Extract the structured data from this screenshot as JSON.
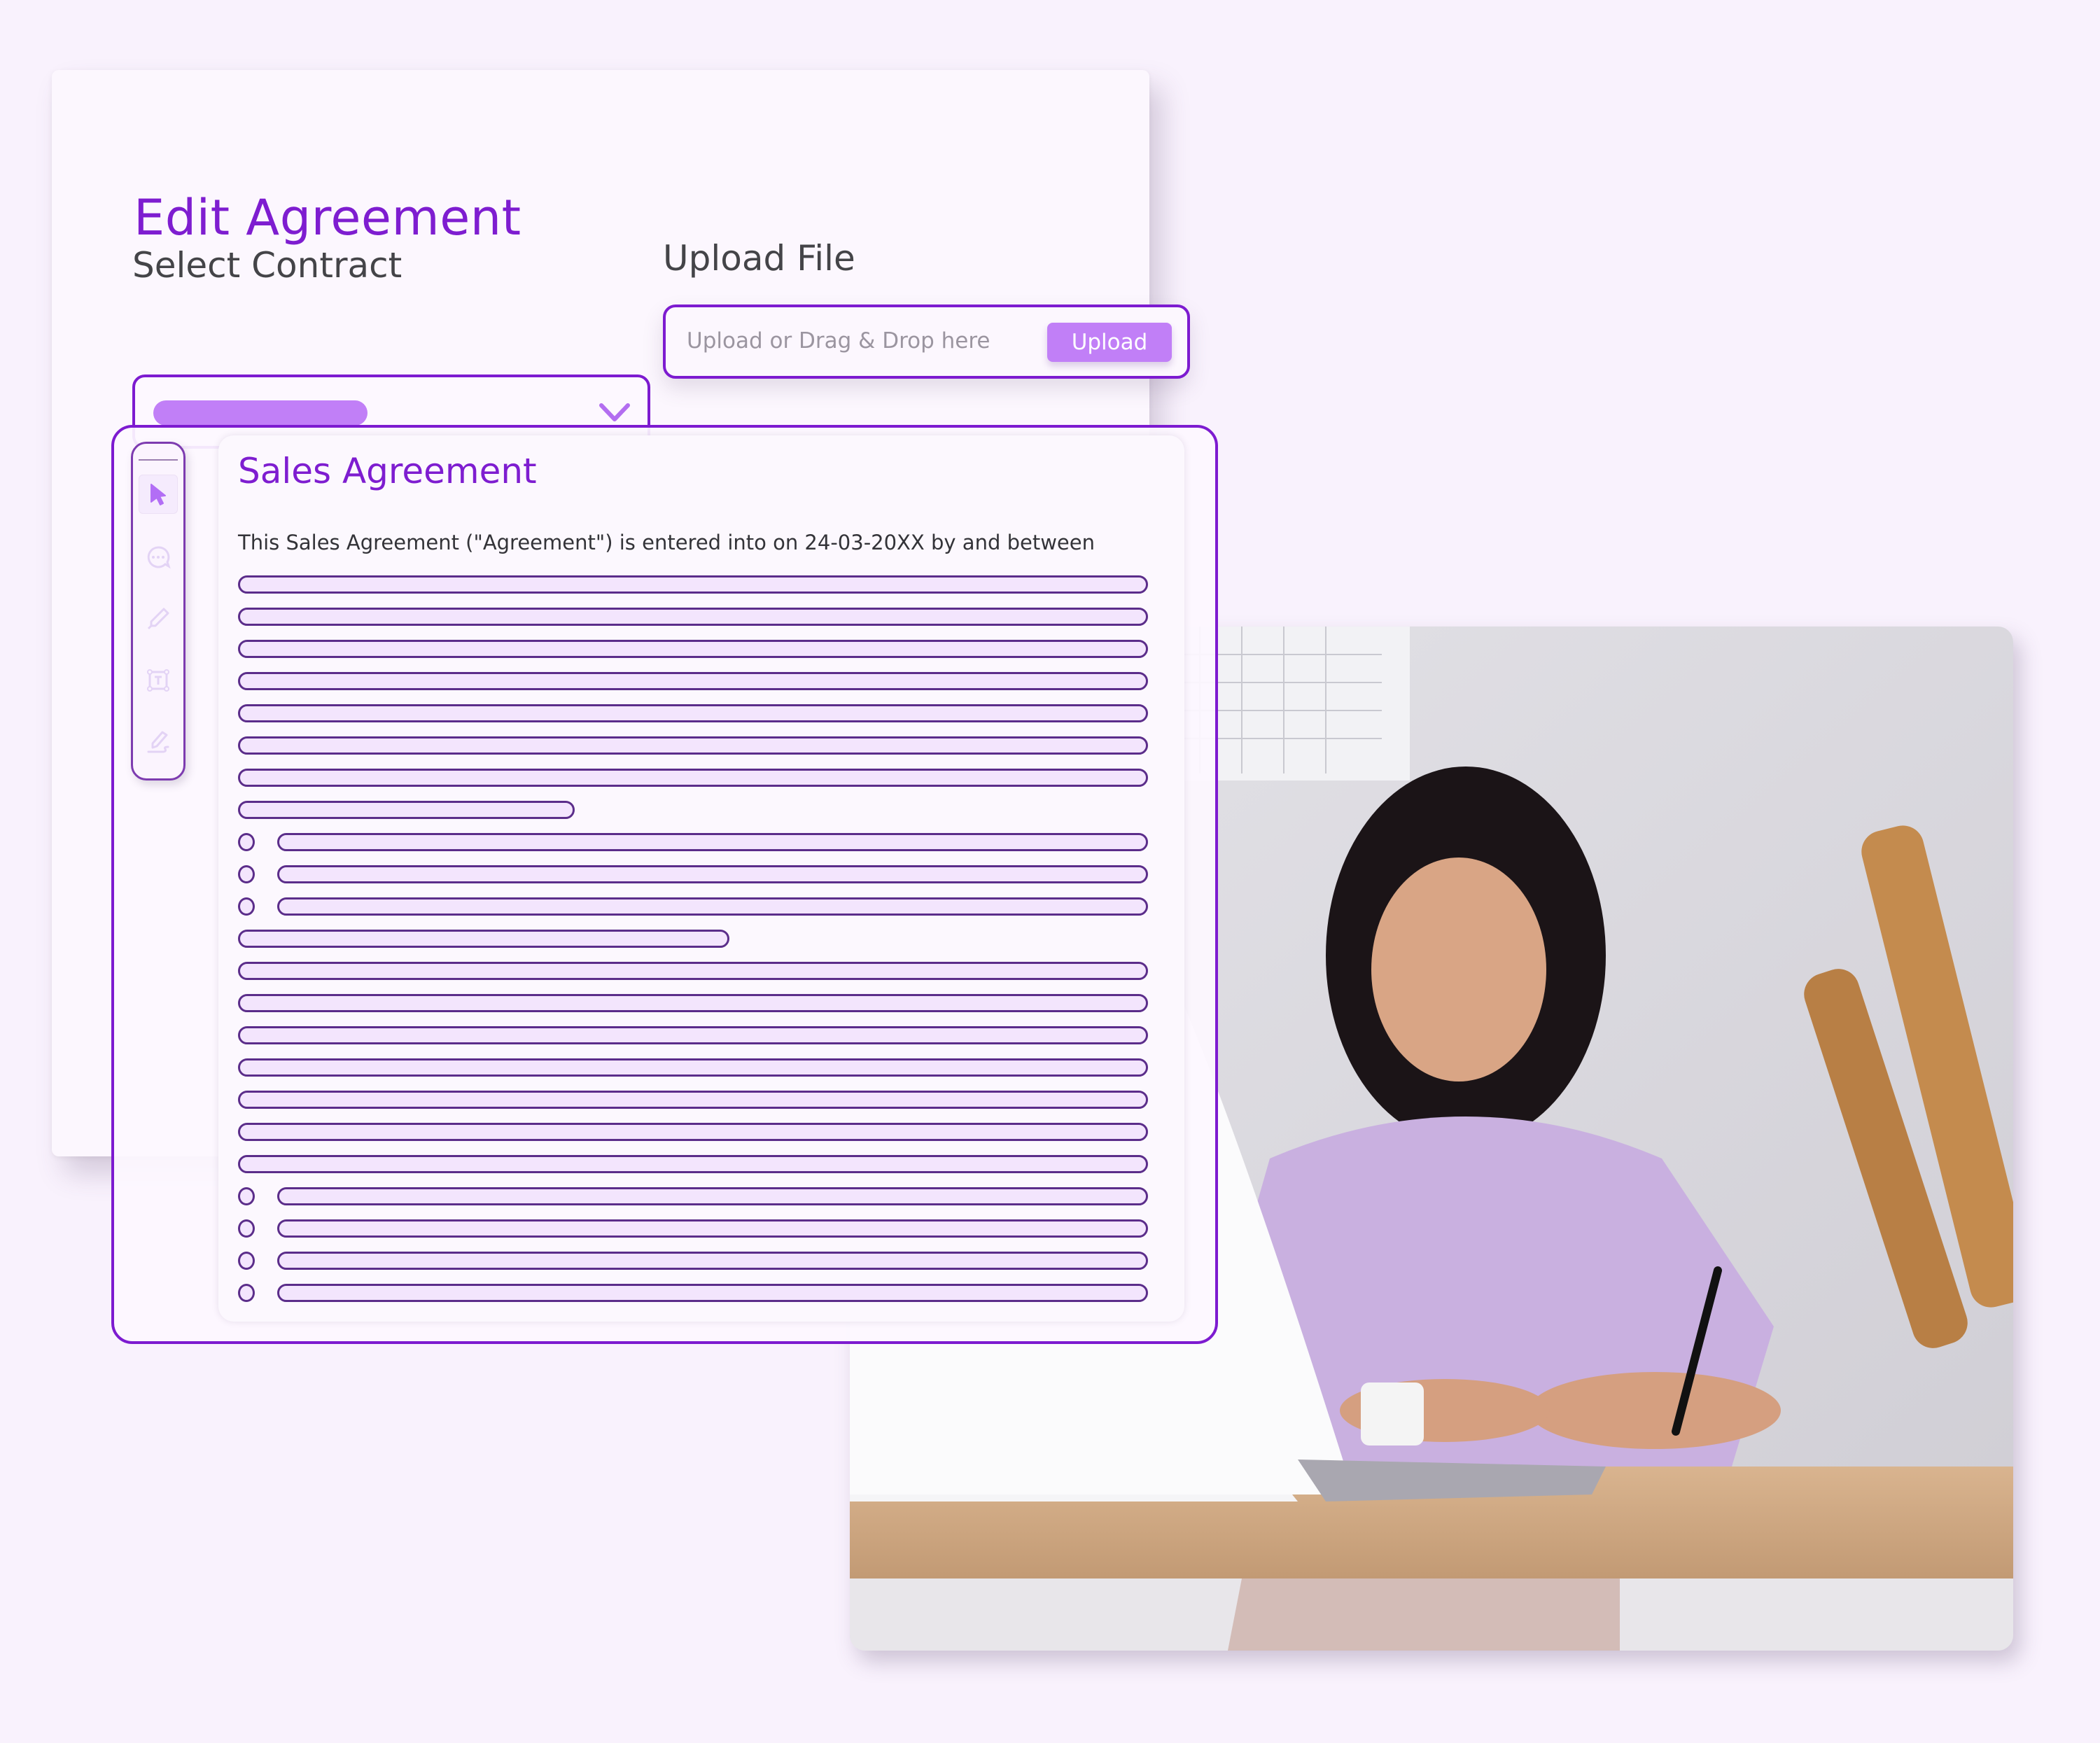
{
  "edit_panel": {
    "title": "Edit Agreement",
    "select_contract": {
      "label": "Select Contract",
      "selected_value_placeholder": "redacted-pill",
      "icon": "chevron-down-icon"
    },
    "upload_file": {
      "label": "Upload File",
      "placeholder": "Upload or Drag & Drop here",
      "button_label": "Upload"
    }
  },
  "toolbar": {
    "tools": [
      {
        "name": "select",
        "icon": "cursor-arrow-icon",
        "active": true
      },
      {
        "name": "comment",
        "icon": "chat-bubble-icon",
        "active": false
      },
      {
        "name": "highlight",
        "icon": "highlighter-pen-icon",
        "active": false
      },
      {
        "name": "text-box",
        "icon": "text-box-icon",
        "active": false
      },
      {
        "name": "signature",
        "icon": "signature-pen-icon",
        "active": false
      }
    ]
  },
  "document": {
    "title": "Sales Agreement",
    "intro": "This Sales Agreement (\"Agreement\") is entered into on 24-03-20XX by and between",
    "lines": [
      {
        "type": "full"
      },
      {
        "type": "full"
      },
      {
        "type": "full"
      },
      {
        "type": "full"
      },
      {
        "type": "full"
      },
      {
        "type": "full"
      },
      {
        "type": "full"
      },
      {
        "type": "short",
        "length": 0.37
      },
      {
        "type": "bullet"
      },
      {
        "type": "bullet"
      },
      {
        "type": "bullet"
      },
      {
        "type": "short",
        "length": 0.54
      },
      {
        "type": "full"
      },
      {
        "type": "full"
      },
      {
        "type": "full"
      },
      {
        "type": "full"
      },
      {
        "type": "full"
      },
      {
        "type": "full"
      },
      {
        "type": "full"
      },
      {
        "type": "bullet"
      },
      {
        "type": "bullet"
      },
      {
        "type": "bullet"
      },
      {
        "type": "bullet"
      }
    ]
  },
  "photo": {
    "description": "Woman in lavender t-shirt working at a laptop with a stylus, kraft paper rolls and calendar on wall"
  },
  "colors": {
    "accent": "#7e1dd0",
    "accent_light": "#c17ff7",
    "background": "#f9f2fd",
    "line_stroke": "#5b2d8a",
    "line_fill": "#f3e5fd"
  }
}
